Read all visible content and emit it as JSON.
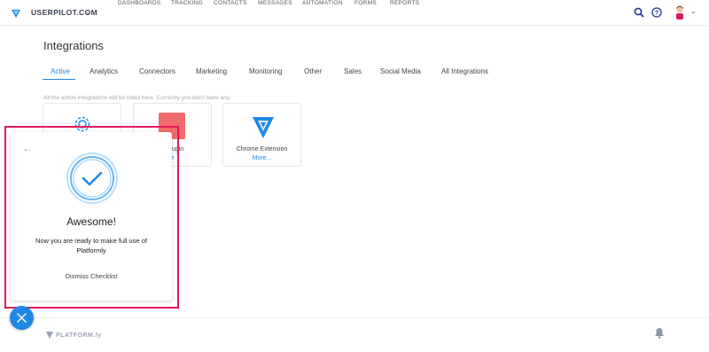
{
  "topbar": {
    "brand": "USERPILOT.COM",
    "nav": [
      "DASHBOARDS",
      "TRACKING",
      "CONTACTS",
      "MESSAGES",
      "AUTOMATION",
      "FORMS",
      "REPORTS"
    ]
  },
  "page": {
    "title": "Integrations",
    "tabs": [
      "Active",
      "Analytics",
      "Connectors",
      "Marketing",
      "Monitoring",
      "Other",
      "Sales",
      "Social Media",
      "All Integrations"
    ],
    "active_tab": "Active",
    "hint": "All the active integrations will be listed here. Currently you don't have any."
  },
  "cards": [
    {
      "title": "",
      "more": ""
    },
    {
      "title": "p Plugin",
      "more": "e"
    },
    {
      "title": "Chrome Extension",
      "more": "More..."
    }
  ],
  "checklist": {
    "title": "Awesome!",
    "description": "Now you are ready to make full use of Platformly",
    "dismiss": "Dismiss Checklist"
  },
  "footer": {
    "logo_text": "PLATFORM.ly"
  },
  "colors": {
    "accent": "#1e88e5",
    "highlight": "#e0195d"
  }
}
